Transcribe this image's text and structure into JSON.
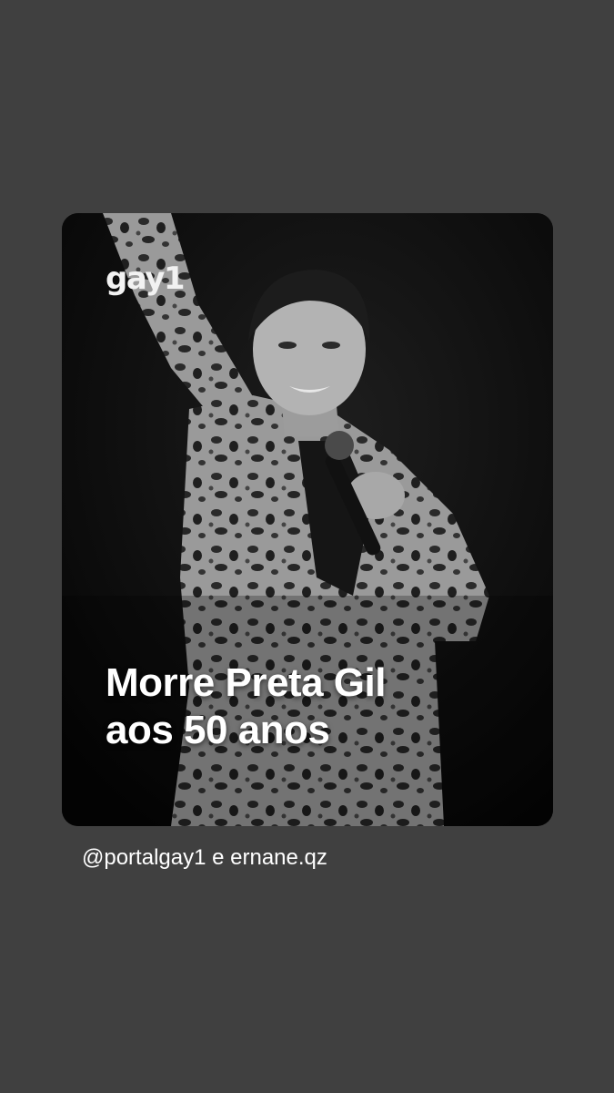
{
  "post": {
    "brand": "gay1",
    "headline_line1": "Morre Preta Gil",
    "headline_line2": "aos 50 anos",
    "credit": "@portalgay1 e ernane.qz"
  },
  "colors": {
    "background": "#404040",
    "card_background": "#0d0d0d",
    "text": "#ffffff"
  }
}
